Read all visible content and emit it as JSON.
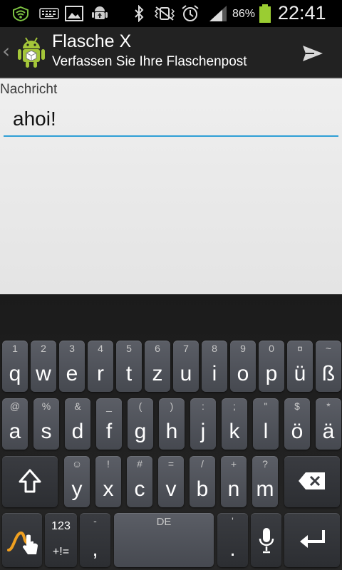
{
  "status": {
    "battery": "86%",
    "time": "22:41"
  },
  "app": {
    "title": "Flasche X",
    "subtitle": "Verfassen Sie Ihre Flaschenpost"
  },
  "form": {
    "label": "Nachricht",
    "value": "ahoi!"
  },
  "keyboard": {
    "row1": [
      {
        "main": "q",
        "sec": "1"
      },
      {
        "main": "w",
        "sec": "2"
      },
      {
        "main": "e",
        "sec": "3"
      },
      {
        "main": "r",
        "sec": "4"
      },
      {
        "main": "t",
        "sec": "5"
      },
      {
        "main": "z",
        "sec": "6"
      },
      {
        "main": "u",
        "sec": "7"
      },
      {
        "main": "i",
        "sec": "8"
      },
      {
        "main": "o",
        "sec": "9"
      },
      {
        "main": "p",
        "sec": "0"
      },
      {
        "main": "ü",
        "sec": "¤"
      },
      {
        "main": "ß",
        "sec": "~"
      }
    ],
    "row2": [
      {
        "main": "a",
        "sec": "@"
      },
      {
        "main": "s",
        "sec": "%"
      },
      {
        "main": "d",
        "sec": "&"
      },
      {
        "main": "f",
        "sec": "_"
      },
      {
        "main": "g",
        "sec": "("
      },
      {
        "main": "h",
        "sec": ")"
      },
      {
        "main": "j",
        "sec": ":"
      },
      {
        "main": "k",
        "sec": ";"
      },
      {
        "main": "l",
        "sec": "\""
      },
      {
        "main": "ö",
        "sec": "$"
      },
      {
        "main": "ä",
        "sec": "*"
      }
    ],
    "row3": [
      {
        "main": "y",
        "sec": "☺"
      },
      {
        "main": "x",
        "sec": "!"
      },
      {
        "main": "c",
        "sec": "#"
      },
      {
        "main": "v",
        "sec": "="
      },
      {
        "main": "b",
        "sec": "/"
      },
      {
        "main": "n",
        "sec": "+"
      },
      {
        "main": "m",
        "sec": "?"
      }
    ],
    "sym_top": "123",
    "sym_bottom": "+!=",
    "comma_sec": "-",
    "comma_main": ",",
    "space_label": "DE",
    "period_sec": "'",
    "period_main": "."
  }
}
